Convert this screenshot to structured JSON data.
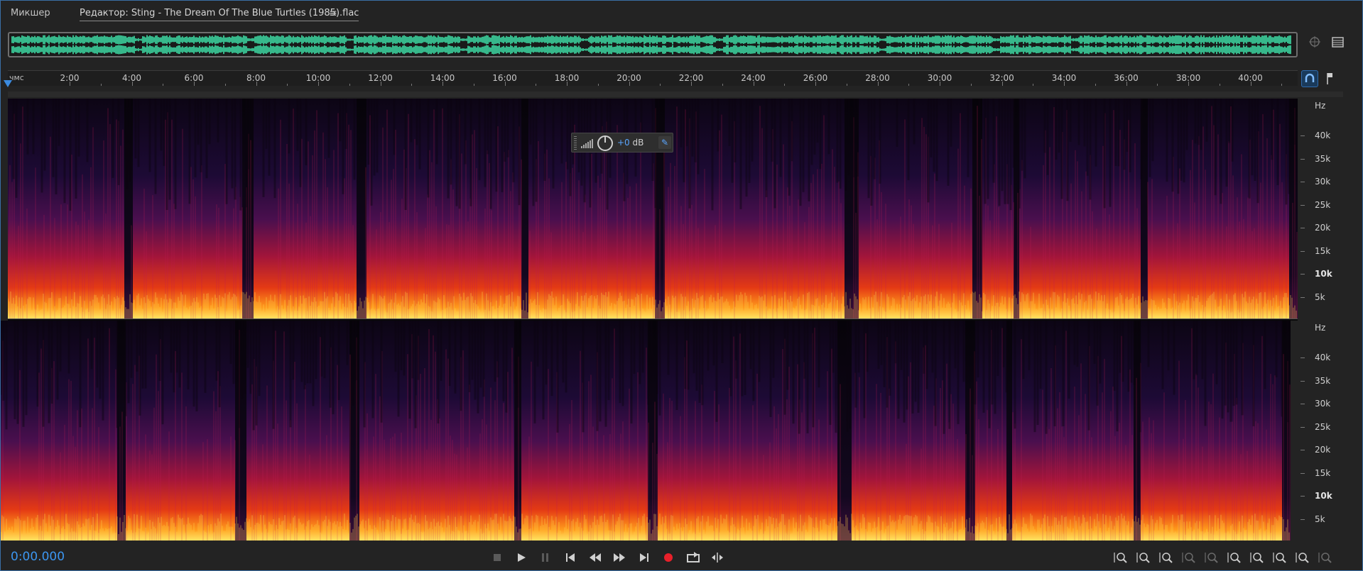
{
  "tabs": {
    "mixer": "Микшер",
    "editor": "Редактор: Sting - The Dream Of The Blue Turtles (1985).flac",
    "menu_icon": "hamburger-icon"
  },
  "ruler": {
    "unit": "чмс",
    "labels": [
      "2:00",
      "4:00",
      "6:00",
      "8:00",
      "10:00",
      "12:00",
      "14:00",
      "16:00",
      "18:00",
      "20:00",
      "22:00",
      "24:00",
      "26:00",
      "28:00",
      "30:00",
      "32:00",
      "34:00",
      "36:00",
      "38:00",
      "40:00"
    ]
  },
  "frequency_axis": {
    "unit": "Hz",
    "labels": [
      "40k",
      "35k",
      "30k",
      "25k",
      "20k",
      "15k",
      "10k",
      "5k"
    ],
    "bold_label": "10k"
  },
  "hud": {
    "value": "+0",
    "unit": "dB"
  },
  "transport": {
    "time": "0:00.000",
    "icons": [
      "stop-icon",
      "play-icon",
      "pause-icon",
      "go-to-start-icon",
      "rewind-icon",
      "fast-forward-icon",
      "go-to-end-icon",
      "record-icon",
      "loop-playback-icon",
      "skip-selection-icon"
    ]
  },
  "zoom_tools": {
    "icons": [
      "zoom-in-amplitude-icon",
      "zoom-out-amplitude-icon",
      "zoom-in-time-icon",
      "zoom-out-time-icon",
      "zoom-full-icon",
      "zoom-in-selection-icon",
      "zoom-out-selection-icon",
      "zoom-to-selection-icon",
      "zoom-reset-icon",
      "zoom-extra-icon"
    ]
  },
  "colors": {
    "accent": "#3c96f0",
    "waveform": "#3fe0a8",
    "record": "#e8202a"
  }
}
